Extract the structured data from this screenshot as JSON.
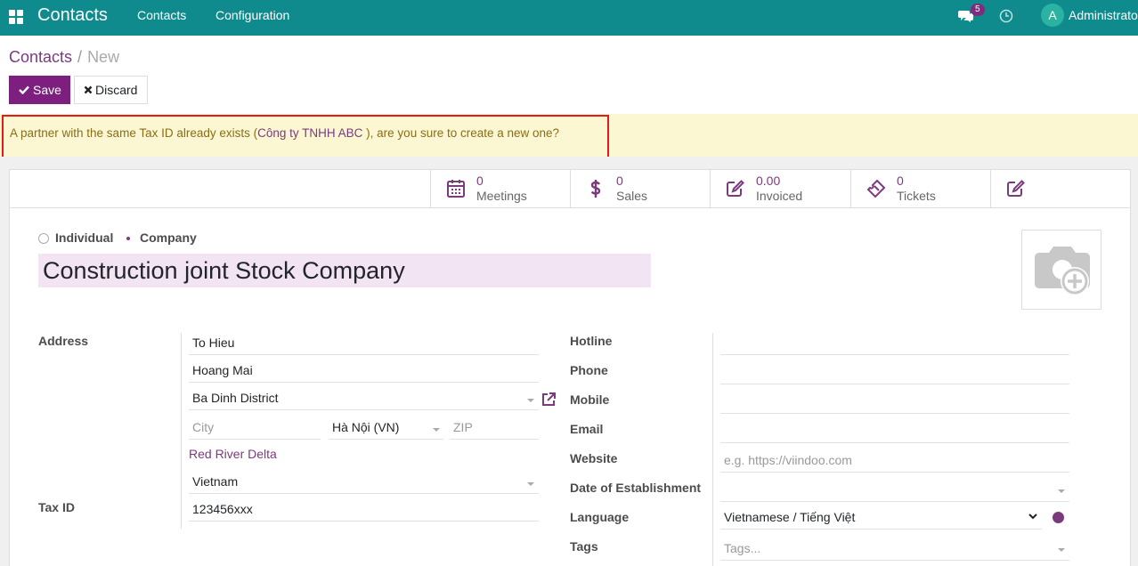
{
  "nav": {
    "brand": "Contacts",
    "menu": [
      "Contacts",
      "Configuration"
    ],
    "chat_badge": "5",
    "avatar_letter": "A",
    "user_name": "Administrator"
  },
  "breadcrumb": {
    "parent": "Contacts",
    "separator": "/",
    "current": "New"
  },
  "buttons": {
    "save": "Save",
    "discard": "Discard"
  },
  "alert": {
    "prefix": "A partner with the same Tax ID already exists (",
    "link": "Công ty TNHH ABC",
    "suffix": " ), are you sure to create a new one?"
  },
  "smart_buttons": [
    {
      "value": "0",
      "label": "Meetings",
      "icon": "calendar-icon"
    },
    {
      "value": "0",
      "label": "Sales",
      "icon": "dollar-icon"
    },
    {
      "value": "0.00",
      "label": "Invoiced",
      "icon": "pencil-square-icon"
    },
    {
      "value": "0",
      "label": "Tickets",
      "icon": "ticket-icon"
    },
    {
      "value": "",
      "label": "",
      "icon": "edit-icon"
    }
  ],
  "company_type": {
    "individual": "Individual",
    "company": "Company",
    "selected": "company"
  },
  "name": "Construction joint Stock Company",
  "address": {
    "label": "Address",
    "street": "To Hieu",
    "street2": "Hoang Mai",
    "district": "Ba Dinh District",
    "city_placeholder": "City",
    "state": "Hà Nội (VN)",
    "zip_placeholder": "ZIP",
    "region": "Red River Delta",
    "country": "Vietnam"
  },
  "tax": {
    "label": "Tax ID",
    "value": "123456xxx"
  },
  "right_fields": {
    "hotline": "Hotline",
    "phone": "Phone",
    "mobile": "Mobile",
    "email": "Email",
    "website": "Website",
    "website_placeholder": "e.g. https://viindoo.com",
    "establishment": "Date of Establishment",
    "language": "Language",
    "language_value": "Vietnamese / Tiếng Việt",
    "tags": "Tags",
    "tags_placeholder": "Tags..."
  },
  "colors": {
    "navbar": "#0f8b8d",
    "primary": "#7d1f7e",
    "link": "#7c3a7e",
    "alert_bg": "#fbf7d2",
    "alert_border": "#e01b1b"
  }
}
